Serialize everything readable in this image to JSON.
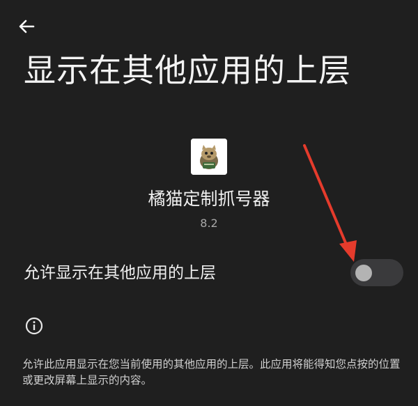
{
  "header": {
    "back_icon": "arrow-left-icon"
  },
  "page": {
    "title": "显示在其他应用的上层"
  },
  "app": {
    "icon": "app-cat-icon",
    "name": "橘猫定制抓号器",
    "version": "8.2"
  },
  "setting": {
    "label": "允许显示在其他应用的上层",
    "toggle_state": "off"
  },
  "info": {
    "icon": "info-icon",
    "description": "允许此应用显示在您当前使用的其他应用的上层。此应用将能得知您点按的位置或更改屏幕上显示的内容。"
  },
  "annotation": {
    "color": "#e53b2c",
    "icon": "red-arrow-annotation"
  },
  "colors": {
    "background": "#1f1f1f",
    "toggle_track": "#3a3a3c",
    "toggle_thumb": "#b3b3b3"
  }
}
